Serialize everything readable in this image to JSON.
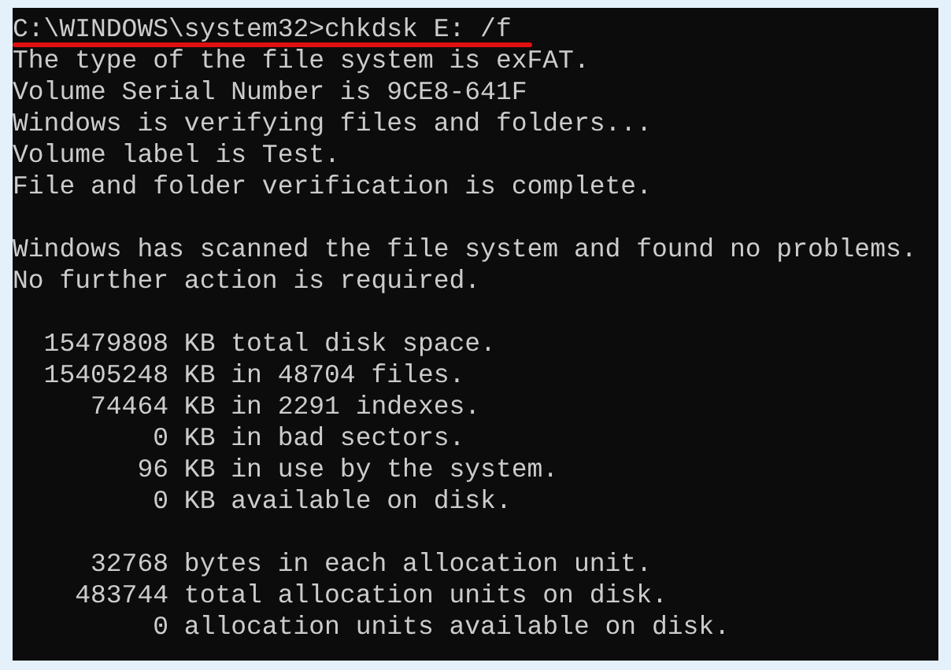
{
  "console": {
    "command": {
      "text": "C:\\WINDOWS\\system32>chkdsk E: /f",
      "underlined": true
    },
    "blocks": [
      [
        "The type of the file system is exFAT.",
        "Volume Serial Number is 9CE8-641F",
        "Windows is verifying files and folders...",
        "Volume label is Test.",
        "File and folder verification is complete."
      ],
      [
        "Windows has scanned the file system and found no problems.",
        "No further action is required."
      ],
      [
        "  15479808 KB total disk space.",
        "  15405248 KB in 48704 files.",
        "     74464 KB in 2291 indexes.",
        "         0 KB in bad sectors.",
        "        96 KB in use by the system.",
        "         0 KB available on disk."
      ],
      [
        "     32768 bytes in each allocation unit.",
        "    483744 total allocation units on disk.",
        "         0 allocation units available on disk."
      ]
    ]
  }
}
